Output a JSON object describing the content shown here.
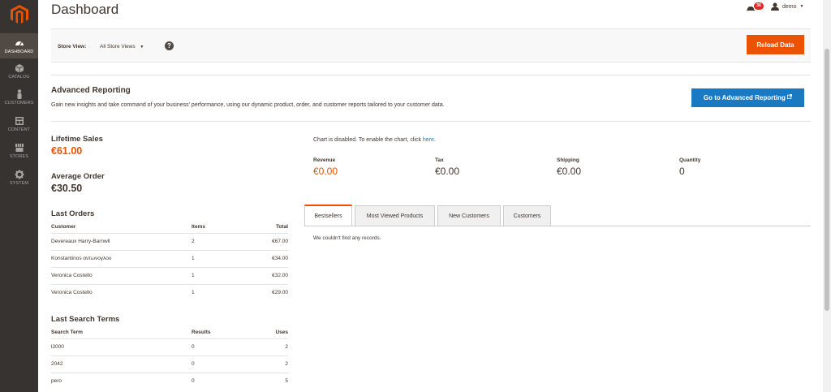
{
  "header": {
    "title": "Dashboard",
    "notification_count": "36",
    "user": "demo"
  },
  "sidebar": {
    "items": [
      {
        "label": "DASHBOARD",
        "icon": "dashboard-icon"
      },
      {
        "label": "CATALOG",
        "icon": "box-icon"
      },
      {
        "label": "CUSTOMERS",
        "icon": "person-icon"
      },
      {
        "label": "CONTENT",
        "icon": "layout-icon"
      },
      {
        "label": "STORES",
        "icon": "store-icon"
      },
      {
        "label": "SYSTEM",
        "icon": "gear-icon"
      }
    ]
  },
  "storebar": {
    "label": "Store View:",
    "selected": "All Store Views",
    "help": "?",
    "reload_label": "Reload Data"
  },
  "advanced": {
    "title": "Advanced Reporting",
    "text": "Gain new insights and take command of your business' performance, using our dynamic product, order, and customer reports tailored to your customer data.",
    "button": "Go to Advanced Reporting"
  },
  "stats": {
    "lifetime_label": "Lifetime Sales",
    "lifetime_value": "€61.00",
    "average_label": "Average Order",
    "average_value": "€30.50"
  },
  "last_orders": {
    "title": "Last Orders",
    "headers": [
      "Customer",
      "Items",
      "Total"
    ],
    "rows": [
      [
        "Devereaux Harry-Barnwll",
        "2",
        "€67.00"
      ],
      [
        "Konstantinos αντωνογλου",
        "1",
        "€34.00"
      ],
      [
        "Veronica Costello",
        "1",
        "€32.00"
      ],
      [
        "Veronica Costello",
        "1",
        "€29.00"
      ]
    ]
  },
  "last_search": {
    "title": "Last Search Terms",
    "headers": [
      "Search Term",
      "Results",
      "Uses"
    ],
    "rows": [
      [
        "l2000",
        "0",
        "2"
      ],
      [
        "2042",
        "0",
        "2"
      ],
      [
        "pero",
        "0",
        "5"
      ]
    ]
  },
  "chart": {
    "disabled_text": "Chart is disabled. To enable the chart, click",
    "link": "here",
    "period": "."
  },
  "totals": [
    {
      "label": "Revenue",
      "value": "€0.00"
    },
    {
      "label": "Tax",
      "value": "€0.00"
    },
    {
      "label": "Shipping",
      "value": "€0.00"
    },
    {
      "label": "Quantity",
      "value": "0"
    }
  ],
  "tabs": [
    "Bestsellers",
    "Most Viewed Products",
    "New Customers",
    "Customers"
  ],
  "empty_message": "We couldn't find any records.",
  "colors": {
    "accent": "#eb5202",
    "primary_button": "#1979c3",
    "sidebar": "#373330"
  }
}
